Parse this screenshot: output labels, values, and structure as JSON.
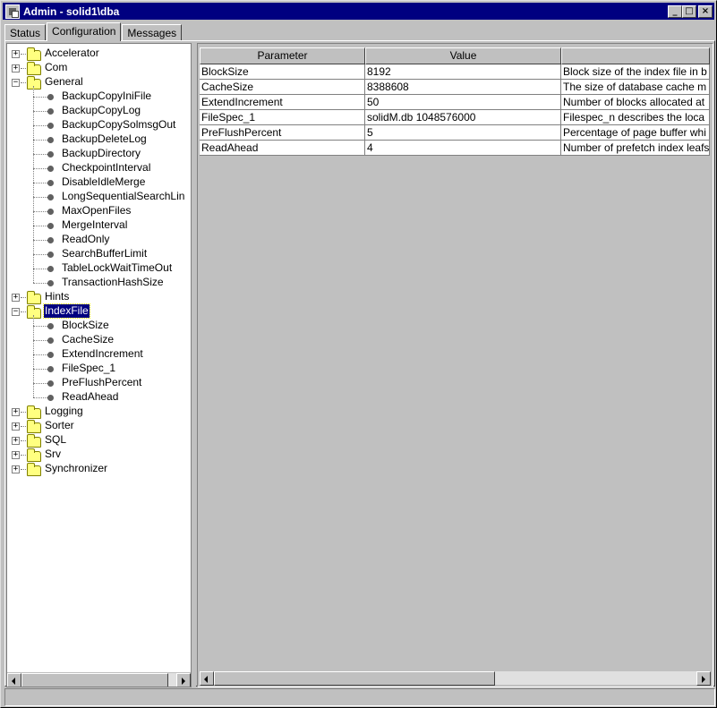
{
  "window": {
    "title": "Admin - solid1\\dba",
    "minimize": "_",
    "maximize": "□",
    "close": "×"
  },
  "tabs": [
    {
      "label": "Status"
    },
    {
      "label": "Configuration",
      "active": true
    },
    {
      "label": "Messages"
    }
  ],
  "tree": {
    "nodes": [
      {
        "label": "Accelerator",
        "type": "folder",
        "expanded": false
      },
      {
        "label": "Com",
        "type": "folder",
        "expanded": false
      },
      {
        "label": "General",
        "type": "folder",
        "expanded": true,
        "children": [
          "BackupCopyIniFile",
          "BackupCopyLog",
          "BackupCopySolmsgOut",
          "BackupDeleteLog",
          "BackupDirectory",
          "CheckpointInterval",
          "DisableIdleMerge",
          "LongSequentialSearchLin",
          "MaxOpenFiles",
          "MergeInterval",
          "ReadOnly",
          "SearchBufferLimit",
          "TableLockWaitTimeOut",
          "TransactionHashSize"
        ]
      },
      {
        "label": "Hints",
        "type": "folder",
        "expanded": false
      },
      {
        "label": "IndexFile",
        "type": "folder",
        "expanded": true,
        "selected": true,
        "children": [
          "BlockSize",
          "CacheSize",
          "ExtendIncrement",
          "FileSpec_1",
          "PreFlushPercent",
          "ReadAhead"
        ]
      },
      {
        "label": "Logging",
        "type": "folder",
        "expanded": false
      },
      {
        "label": "Sorter",
        "type": "folder",
        "expanded": false
      },
      {
        "label": "SQL",
        "type": "folder",
        "expanded": false
      },
      {
        "label": "Srv",
        "type": "folder",
        "expanded": false
      },
      {
        "label": "Synchronizer",
        "type": "folder",
        "expanded": false
      }
    ]
  },
  "table": {
    "columns": [
      "Parameter",
      "Value",
      ""
    ],
    "rows": [
      [
        "BlockSize",
        "8192",
        "Block size of the index file in b"
      ],
      [
        "CacheSize",
        "8388608",
        "The size of database cache m"
      ],
      [
        "ExtendIncrement",
        "50",
        "Number of blocks allocated at"
      ],
      [
        "FileSpec_1",
        "solidM.db 1048576000",
        "Filespec_n describes the loca"
      ],
      [
        "PreFlushPercent",
        "5",
        "Percentage of page buffer whi"
      ],
      [
        "ReadAhead",
        "4",
        "Number of prefetch index leafs"
      ]
    ]
  },
  "colors": {
    "title_bar": "#000080",
    "window_bg": "#c0c0c0",
    "folder": "#ffff80",
    "selection": "#000080"
  },
  "icons": {
    "app": "admin-app-icon",
    "folder": "folder-icon",
    "leaf": "parameter-dot-icon",
    "expand": "plus",
    "collapse": "minus"
  }
}
